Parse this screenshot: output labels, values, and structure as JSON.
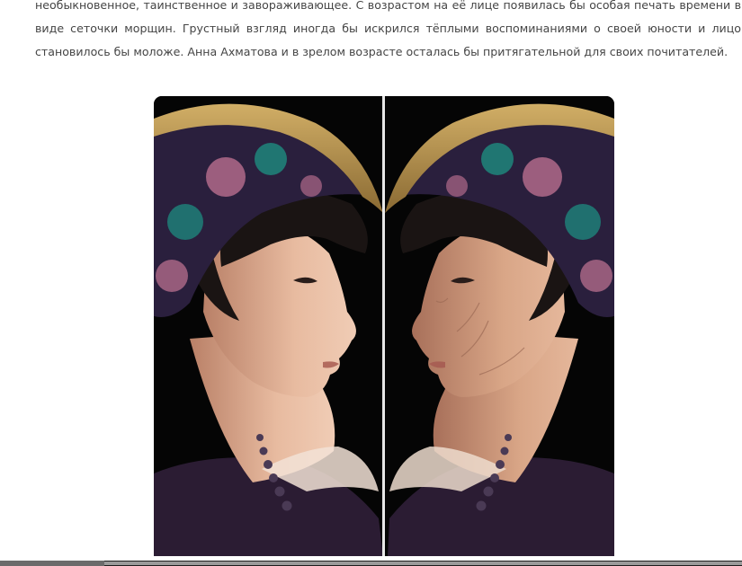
{
  "article": {
    "paragraph": "необыкновенное, таинственное и завораживающее. С возрастом на её лице появилась бы особая печать времени в виде сеточки морщин. Грустный взгляд иногда бы искрился тёплыми воспоминаниями о своей юности и лицо становилось бы моложе. Анна Ахматова и в зрелом возрасте осталась бы притягательной для своих почитателей."
  },
  "photo": {
    "left_face_skin": "#e8bba0",
    "right_face_skin": "#d9a687",
    "hat_brim": "#b08a45",
    "hat_fabric": "#2a1f3d",
    "pattern_pink": "#b06a8a",
    "pattern_teal": "#1f7f78",
    "hair": "#1a1413",
    "background": "#050505",
    "dress": "#2b1c33",
    "bead": "#4a3a55"
  },
  "scrollbar": {
    "thumb_fraction": 0.14
  }
}
